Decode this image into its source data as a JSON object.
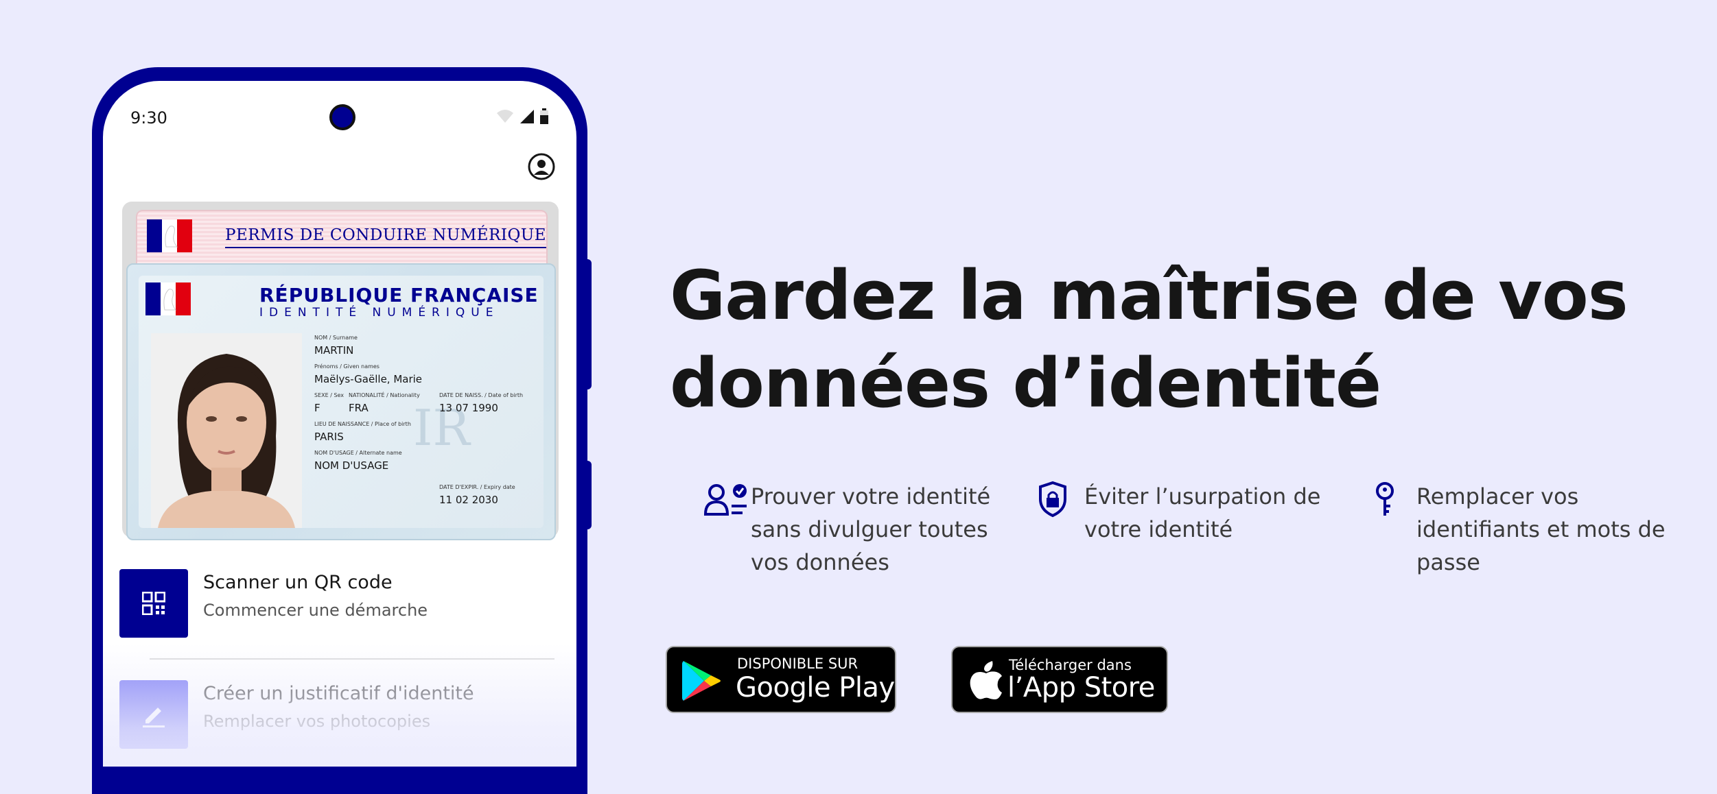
{
  "phone": {
    "status_time": "9:30",
    "permis_title": "PERMIS DE CONDUIRE NUMÉRIQUE",
    "id_card": {
      "republique": "RÉPUBLIQUE FRANÇAISE",
      "subtitle": "IDENTITÉ NUMÉRIQUE",
      "watermark": "IR",
      "fields": {
        "nom_label": "NOM / Surname",
        "nom": "MARTIN",
        "prenoms_label": "Prénoms / Given names",
        "prenoms": "Maëlys-Gaëlle, Marie",
        "sexe_label": "SEXE / Sex",
        "sexe": "F",
        "nationalite_label": "NATIONALITÉ / Nationality",
        "nationalite": "FRA",
        "naissance_label": "DATE DE NAISS. / Date of birth",
        "naissance": "13 07 1990",
        "lieu_label": "LIEU DE NAISSANCE / Place of birth",
        "lieu": "PARIS",
        "usage_label": "NOM D'USAGE / Alternate name",
        "usage": "NOM D'USAGE",
        "expir_label": "DATE D'EXPIR. / Expiry date",
        "expir": "11 02 2030"
      }
    },
    "actions": [
      {
        "title": "Scanner un QR code",
        "subtitle": "Commencer une démarche",
        "icon": "qr-code-icon"
      },
      {
        "title": "Créer un justificatif d'identité",
        "subtitle": "Remplacer vos photocopies",
        "icon": "pencil-icon"
      }
    ]
  },
  "headline": {
    "line1": "Gardez la maîtrise de vos",
    "line2": "données d’identité"
  },
  "features": [
    {
      "icon": "user-check-icon",
      "lines": [
        "Prouver votre identité",
        "sans divulguer toutes",
        "vos données"
      ]
    },
    {
      "icon": "shield-lock-icon",
      "lines": [
        "Éviter l’usurpation de",
        "votre identité"
      ]
    },
    {
      "icon": "key-icon",
      "lines": [
        "Remplacer vos",
        "identifiants et mots de",
        "passe"
      ]
    }
  ],
  "stores": {
    "google": {
      "small": "DISPONIBLE SUR",
      "big": "Google Play"
    },
    "apple": {
      "small": "Télécharger dans",
      "big": "l’App Store"
    }
  },
  "colors": {
    "background": "#ebebfd",
    "brand_blue": "#000091",
    "accent_blue": "#6a6af4",
    "marianne_red": "#e1000f"
  }
}
